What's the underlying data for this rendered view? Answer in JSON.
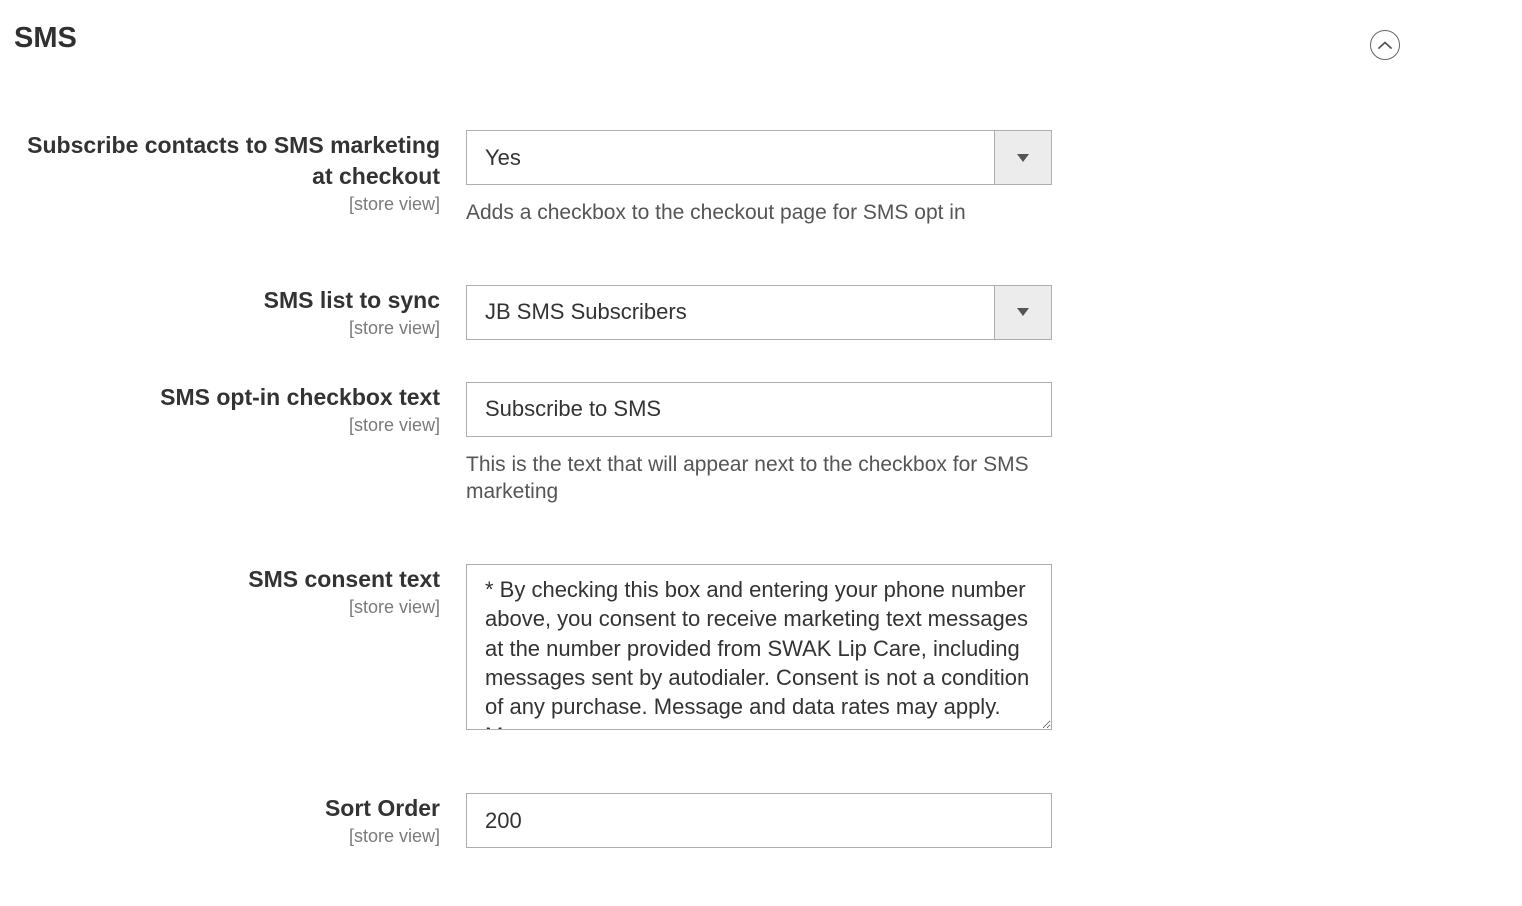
{
  "section": {
    "title": "SMS"
  },
  "fields": {
    "subscribe": {
      "label": "Subscribe contacts to SMS marketing at checkout",
      "scope": "[store view]",
      "value": "Yes",
      "help": "Adds a checkbox to the checkout page for SMS opt in"
    },
    "list": {
      "label": "SMS list to sync",
      "scope": "[store view]",
      "value": "JB SMS Subscribers"
    },
    "checkbox_text": {
      "label": "SMS opt-in checkbox text",
      "scope": "[store view]",
      "value": "Subscribe to SMS",
      "help": "This is the text that will appear next to the checkbox for SMS marketing"
    },
    "consent": {
      "label": "SMS consent text",
      "scope": "[store view]",
      "value": "* By checking this box and entering your phone number above, you consent to receive marketing text messages at the number provided from SWAK Lip Care, including messages sent by autodialer. Consent is not a condition of any purchase. Message and data rates may apply. Message"
    },
    "sort_order": {
      "label": "Sort Order",
      "scope": "[store view]",
      "value": "200"
    }
  }
}
